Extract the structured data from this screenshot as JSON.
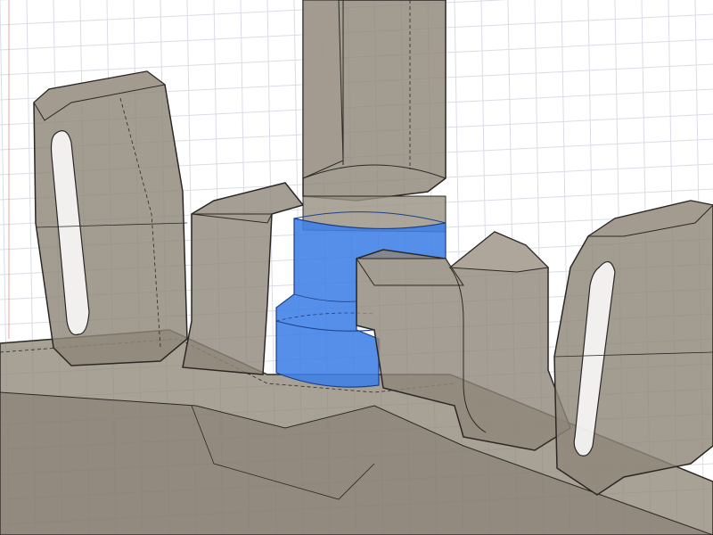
{
  "viewport": {
    "description_visible_text": "",
    "colors": {
      "background": "#ffffff",
      "grid_line": "#dadde6",
      "axis_line": "#f2a0a0",
      "body_fill": "#8f8679",
      "body_fill_light": "#a39b8f",
      "body_fill_dark": "#6f675c",
      "edge": "#2b2824",
      "selection_blue": "#3d7fe6",
      "selection_blue_dark": "#2e64c4"
    },
    "objects": [
      "base-plate",
      "vertical-shaft",
      "selected-cylindrical-face",
      "left-mounting-tab",
      "right-mounting-tab",
      "left-block",
      "right-block"
    ]
  }
}
